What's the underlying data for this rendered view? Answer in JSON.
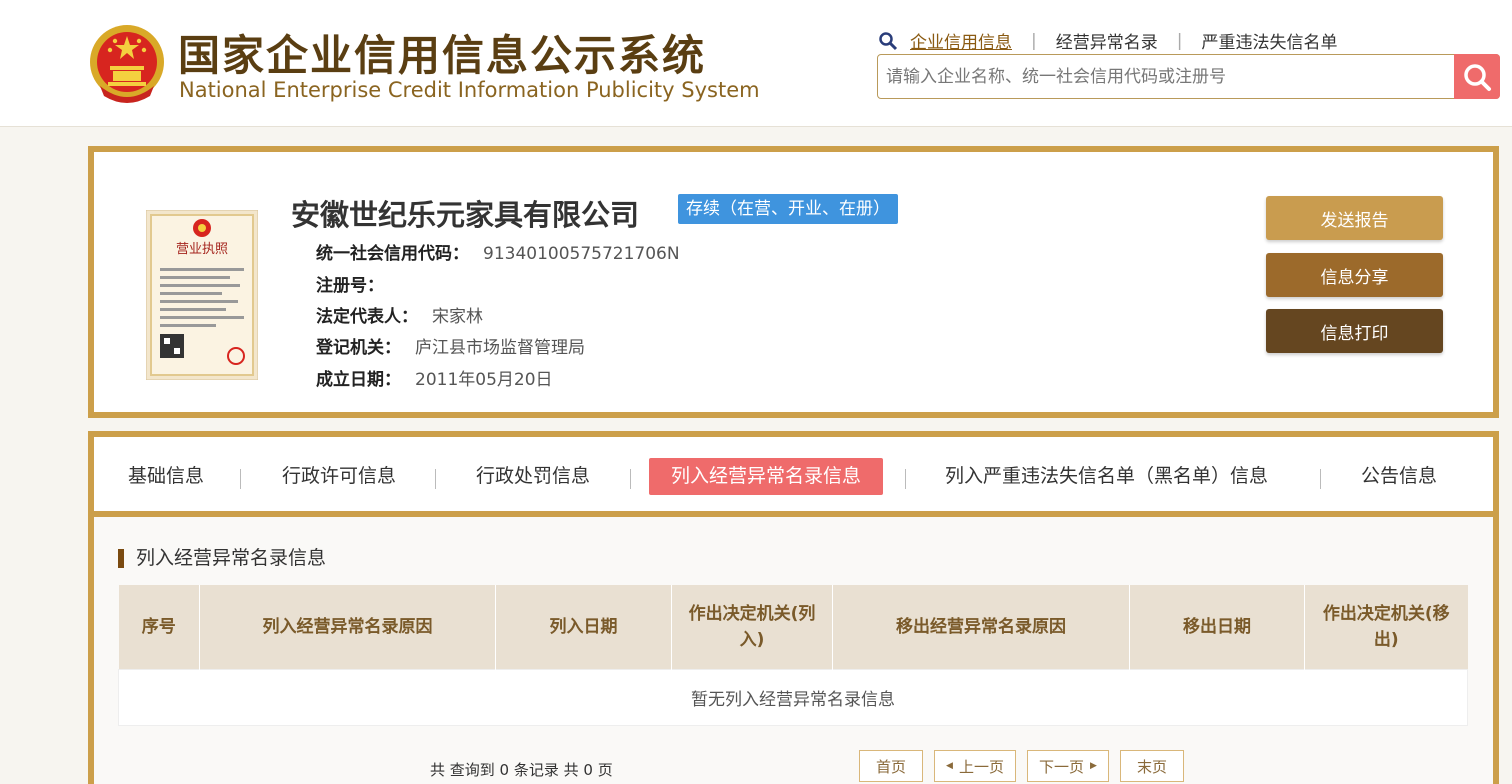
{
  "header": {
    "title": "国家企业信用信息公示系统",
    "subtitle": "National Enterprise Credit Information Publicity System"
  },
  "topnav": {
    "items": [
      {
        "label": "企业信用信息"
      },
      {
        "label": "经营异常名录"
      },
      {
        "label": "严重违法失信名单"
      }
    ]
  },
  "search": {
    "placeholder": "请输入企业名称、统一社会信用代码或注册号",
    "value": ""
  },
  "company": {
    "name": "安徽世纪乐元家具有限公司",
    "status": "存续（在营、开业、在册）",
    "fields": [
      {
        "key": "统一社会信用代码：",
        "value": "91340100575721706N"
      },
      {
        "key": "注册号：",
        "value": ""
      },
      {
        "key": "法定代表人：",
        "value": "宋家林"
      },
      {
        "key": "登记机关：",
        "value": "庐江县市场监督管理局"
      },
      {
        "key": "成立日期：",
        "value": "2011年05月20日"
      }
    ],
    "license_heading": "营业执照"
  },
  "actions": {
    "send_report": "发送报告",
    "share": "信息分享",
    "print": "信息打印"
  },
  "tabs": [
    {
      "label": "基础信息"
    },
    {
      "label": "行政许可信息"
    },
    {
      "label": "行政处罚信息"
    },
    {
      "label": "列入经营异常名录信息"
    },
    {
      "label": "列入严重违法失信名单（黑名单）信息"
    },
    {
      "label": "公告信息"
    }
  ],
  "section": {
    "title": "列入经营异常名录信息",
    "columns": [
      "序号",
      "列入经营异常名录原因",
      "列入日期",
      "作出决定机关(列入)",
      "移出经营异常名录原因",
      "移出日期",
      "作出决定机关(移出)"
    ],
    "empty_text": "暂无列入经营异常名录信息"
  },
  "pagination": {
    "summary": "共 查询到 0 条记录 共 0 页",
    "first": "首页",
    "prev": "上一页",
    "next": "下一页",
    "last": "末页"
  },
  "colors": {
    "gold_border": "#cc9f4a",
    "accent_red": "#ef6b6b",
    "status_blue": "#3f94de",
    "btn_send": "#c99c4f",
    "btn_share": "#9c6a2b",
    "btn_print": "#654620"
  }
}
